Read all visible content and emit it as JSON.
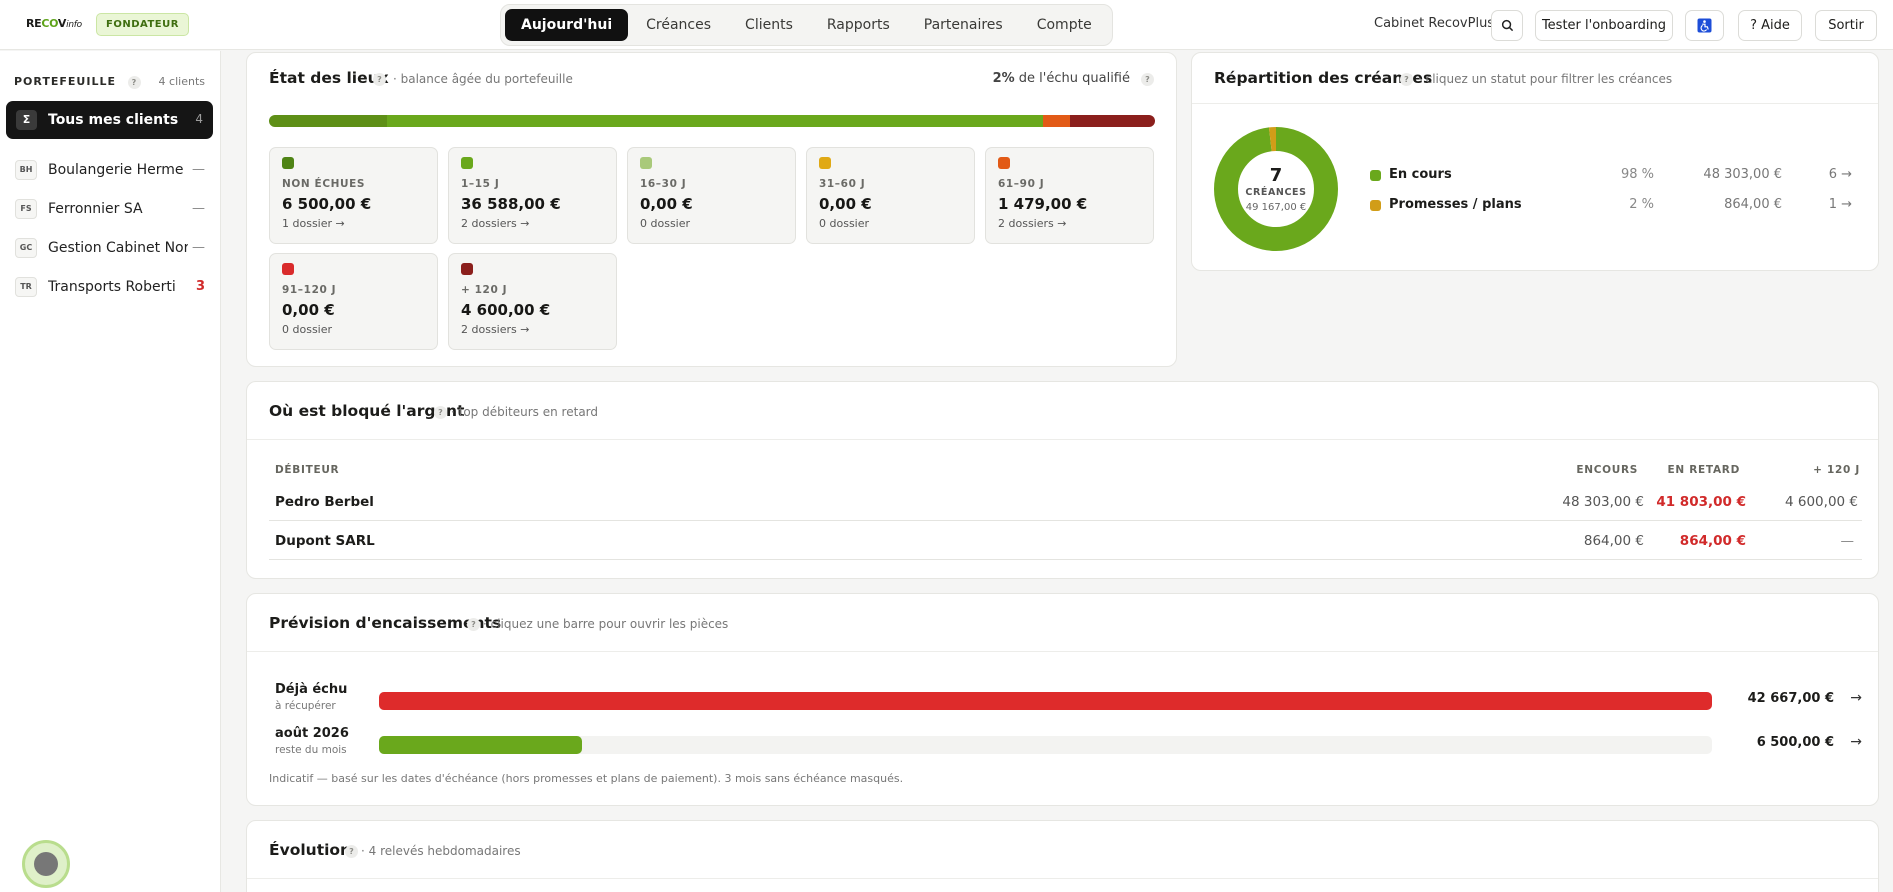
{
  "app": {
    "logo_text": "RECOVinfo",
    "badge": "FONDATEUR",
    "tabs": [
      "Aujourd'hui",
      "Créances",
      "Clients",
      "Rapports",
      "Partenaires",
      "Compte"
    ],
    "active_tab": "Aujourd'hui",
    "cabinet": "Cabinet RecovPlus",
    "onboarding_label": "Tester l'onboarding",
    "help_label": "? Aide",
    "logout_label": "Sortir"
  },
  "sidebar": {
    "title": "PORTEFEUILLE",
    "count": "4 clients",
    "all_symbol": "Σ",
    "all_label": "Tous mes clients",
    "all_count": "4",
    "items": [
      {
        "initials": "BH",
        "label": "Boulangerie Herme",
        "count": "—",
        "alert": false
      },
      {
        "initials": "FS",
        "label": "Ferronnier SA",
        "count": "—",
        "alert": false
      },
      {
        "initials": "GC",
        "label": "Gestion Cabinet Nor…",
        "count": "—",
        "alert": false
      },
      {
        "initials": "TR",
        "label": "Transports Roberti",
        "count": "3",
        "alert": true
      }
    ]
  },
  "etat": {
    "title": "État des lieux",
    "subtitle": "· balance âgée du portefeuille",
    "qualified_pct": "2%",
    "qualified_text": "de l'échu qualifié",
    "bar_segments": [
      {
        "color": "#5e8f17",
        "share": 0.133
      },
      {
        "color": "#6aa81c",
        "share": 0.741
      },
      {
        "color": "#e25a16",
        "share": 0.03
      },
      {
        "color": "#8b1f1c",
        "share": 0.096
      }
    ],
    "buckets": [
      {
        "label": "NON ÉCHUES",
        "value": "6 500,00 €",
        "count": "1 dossier →",
        "color": "#4f8415"
      },
      {
        "label": "1–15 J",
        "value": "36 588,00 €",
        "count": "2 dossiers →",
        "color": "#6aa81c"
      },
      {
        "label": "16–30 J",
        "value": "0,00 €",
        "count": "0 dossier",
        "color": "#a9c97a"
      },
      {
        "label": "31–60 J",
        "value": "0,00 €",
        "count": "0 dossier",
        "color": "#e0a915"
      },
      {
        "label": "61–90 J",
        "value": "1 479,00 €",
        "count": "2 dossiers →",
        "color": "#e25a16"
      },
      {
        "label": "91–120 J",
        "value": "0,00 €",
        "count": "0 dossier",
        "color": "#d92b2b"
      },
      {
        "label": "+ 120 J",
        "value": "4 600,00 €",
        "count": "2 dossiers →",
        "color": "#8b1f1c"
      }
    ]
  },
  "repartition": {
    "title": "Répartition des créances",
    "subtitle": "· cliquez un statut pour filtrer les créances",
    "total_count": "7",
    "total_label": "CRÉANCES",
    "total_amount": "49 167,00 €",
    "statuses": [
      {
        "name": "En cours",
        "pct": "98 %",
        "amount": "48 303,00 €",
        "count": "6 →",
        "color": "#6aa81c",
        "share": 0.98
      },
      {
        "name": "Promesses / plans",
        "pct": "2 %",
        "amount": "864,00 €",
        "count": "1 →",
        "color": "#d19d18",
        "share": 0.02
      }
    ]
  },
  "bloque": {
    "title": "Où est bloqué l'argent",
    "subtitle": "· top débiteurs en retard",
    "headers": {
      "debtor": "DÉBITEUR",
      "encours": "ENCOURS",
      "retard": "EN RETARD",
      "plus120": "+ 120 J"
    },
    "rows": [
      {
        "debtor": "Pedro Berbel",
        "encours": "48 303,00 €",
        "retard": "41 803,00 €",
        "plus120": "4 600,00 €"
      },
      {
        "debtor": "Dupont SARL",
        "encours": "864,00 €",
        "retard": "864,00 €",
        "plus120": "—"
      }
    ]
  },
  "prevision": {
    "title": "Prévision d'encaissements",
    "subtitle": "· cliquez une barre pour ouvrir les pièces",
    "rows": [
      {
        "label": "Déjà échu",
        "sub": "à récupérer",
        "value": "42 667,00 €",
        "arrow": "→",
        "fraction": 1.0,
        "color": "#de2b2b"
      },
      {
        "label": "août 2026",
        "sub": "reste du mois",
        "value": "6 500,00 €",
        "arrow": "→",
        "fraction": 0.152,
        "color": "#6aa81c"
      }
    ],
    "note": "Indicatif — basé sur les dates d'échéance (hors promesses et plans de paiement). 3 mois sans échéance masqués."
  },
  "evolution": {
    "title": "Évolution",
    "subtitle": "· 4 relevés hebdomadaires"
  }
}
